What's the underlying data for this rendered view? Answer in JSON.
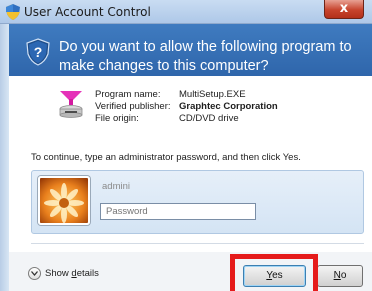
{
  "window": {
    "title": "User Account Control",
    "close_label": "x"
  },
  "banner": {
    "message": "Do you want to allow the following program to make changes to this computer?",
    "bg_color": "#3f7bc0"
  },
  "program": {
    "name_label": "Program name:",
    "name_value": "MultiSetup.EXE",
    "publisher_label": "Verified publisher:",
    "publisher_value": "Graphtec Corporation",
    "origin_label": "File origin:",
    "origin_value": "CD/DVD drive",
    "icon": "installer-icon"
  },
  "prompt": {
    "instruction": "To continue, type an administrator password, and then click Yes."
  },
  "credential": {
    "username": "admini",
    "password_placeholder": "Password",
    "avatar_icon": "user-avatar-flower"
  },
  "footer": {
    "details_prefix": "Show ",
    "details_accel": "d",
    "details_suffix": "etails",
    "yes_accel": "Y",
    "yes_rest": "es",
    "no_accel": "N",
    "no_rest": "o"
  },
  "colors": {
    "highlight": "#e51b1b",
    "accent": "#3c7fb1"
  }
}
